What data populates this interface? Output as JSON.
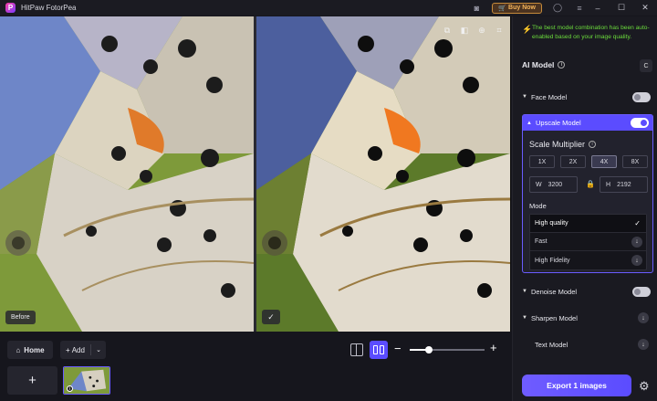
{
  "app": {
    "title": "HitPaw FotorPea",
    "buy_label": "Buy Now"
  },
  "canvas": {
    "before_label": "Before"
  },
  "bottom": {
    "home_label": "Home",
    "add_label": "Add",
    "zoom": 0.26
  },
  "panel": {
    "notice": "The best model combination has been auto-enabled based on your image quality.",
    "ai_model_title": "AI Model",
    "models": {
      "face": {
        "label": "Face Model",
        "enabled": false
      },
      "upscale": {
        "label": "Upscale Model",
        "enabled": true
      },
      "denoise": {
        "label": "Denoise Model",
        "enabled": false
      },
      "sharpen": {
        "label": "Sharpen Model"
      },
      "text": {
        "label": "Text Model"
      }
    },
    "scale": {
      "title": "Scale Multiplier",
      "options": [
        "1X",
        "2X",
        "4X",
        "8X"
      ],
      "selected": "4X",
      "width_label": "W",
      "width_value": "3200",
      "height_label": "H",
      "height_value": "2192"
    },
    "mode": {
      "title": "Mode",
      "options": [
        "High quality",
        "Fast",
        "High Fidelity"
      ],
      "selected": "High quality"
    },
    "export_label": "Export 1 images"
  },
  "colors": {
    "accent": "#5b4cff",
    "notice": "#6bdc3c",
    "buy": "#f3b45a"
  }
}
